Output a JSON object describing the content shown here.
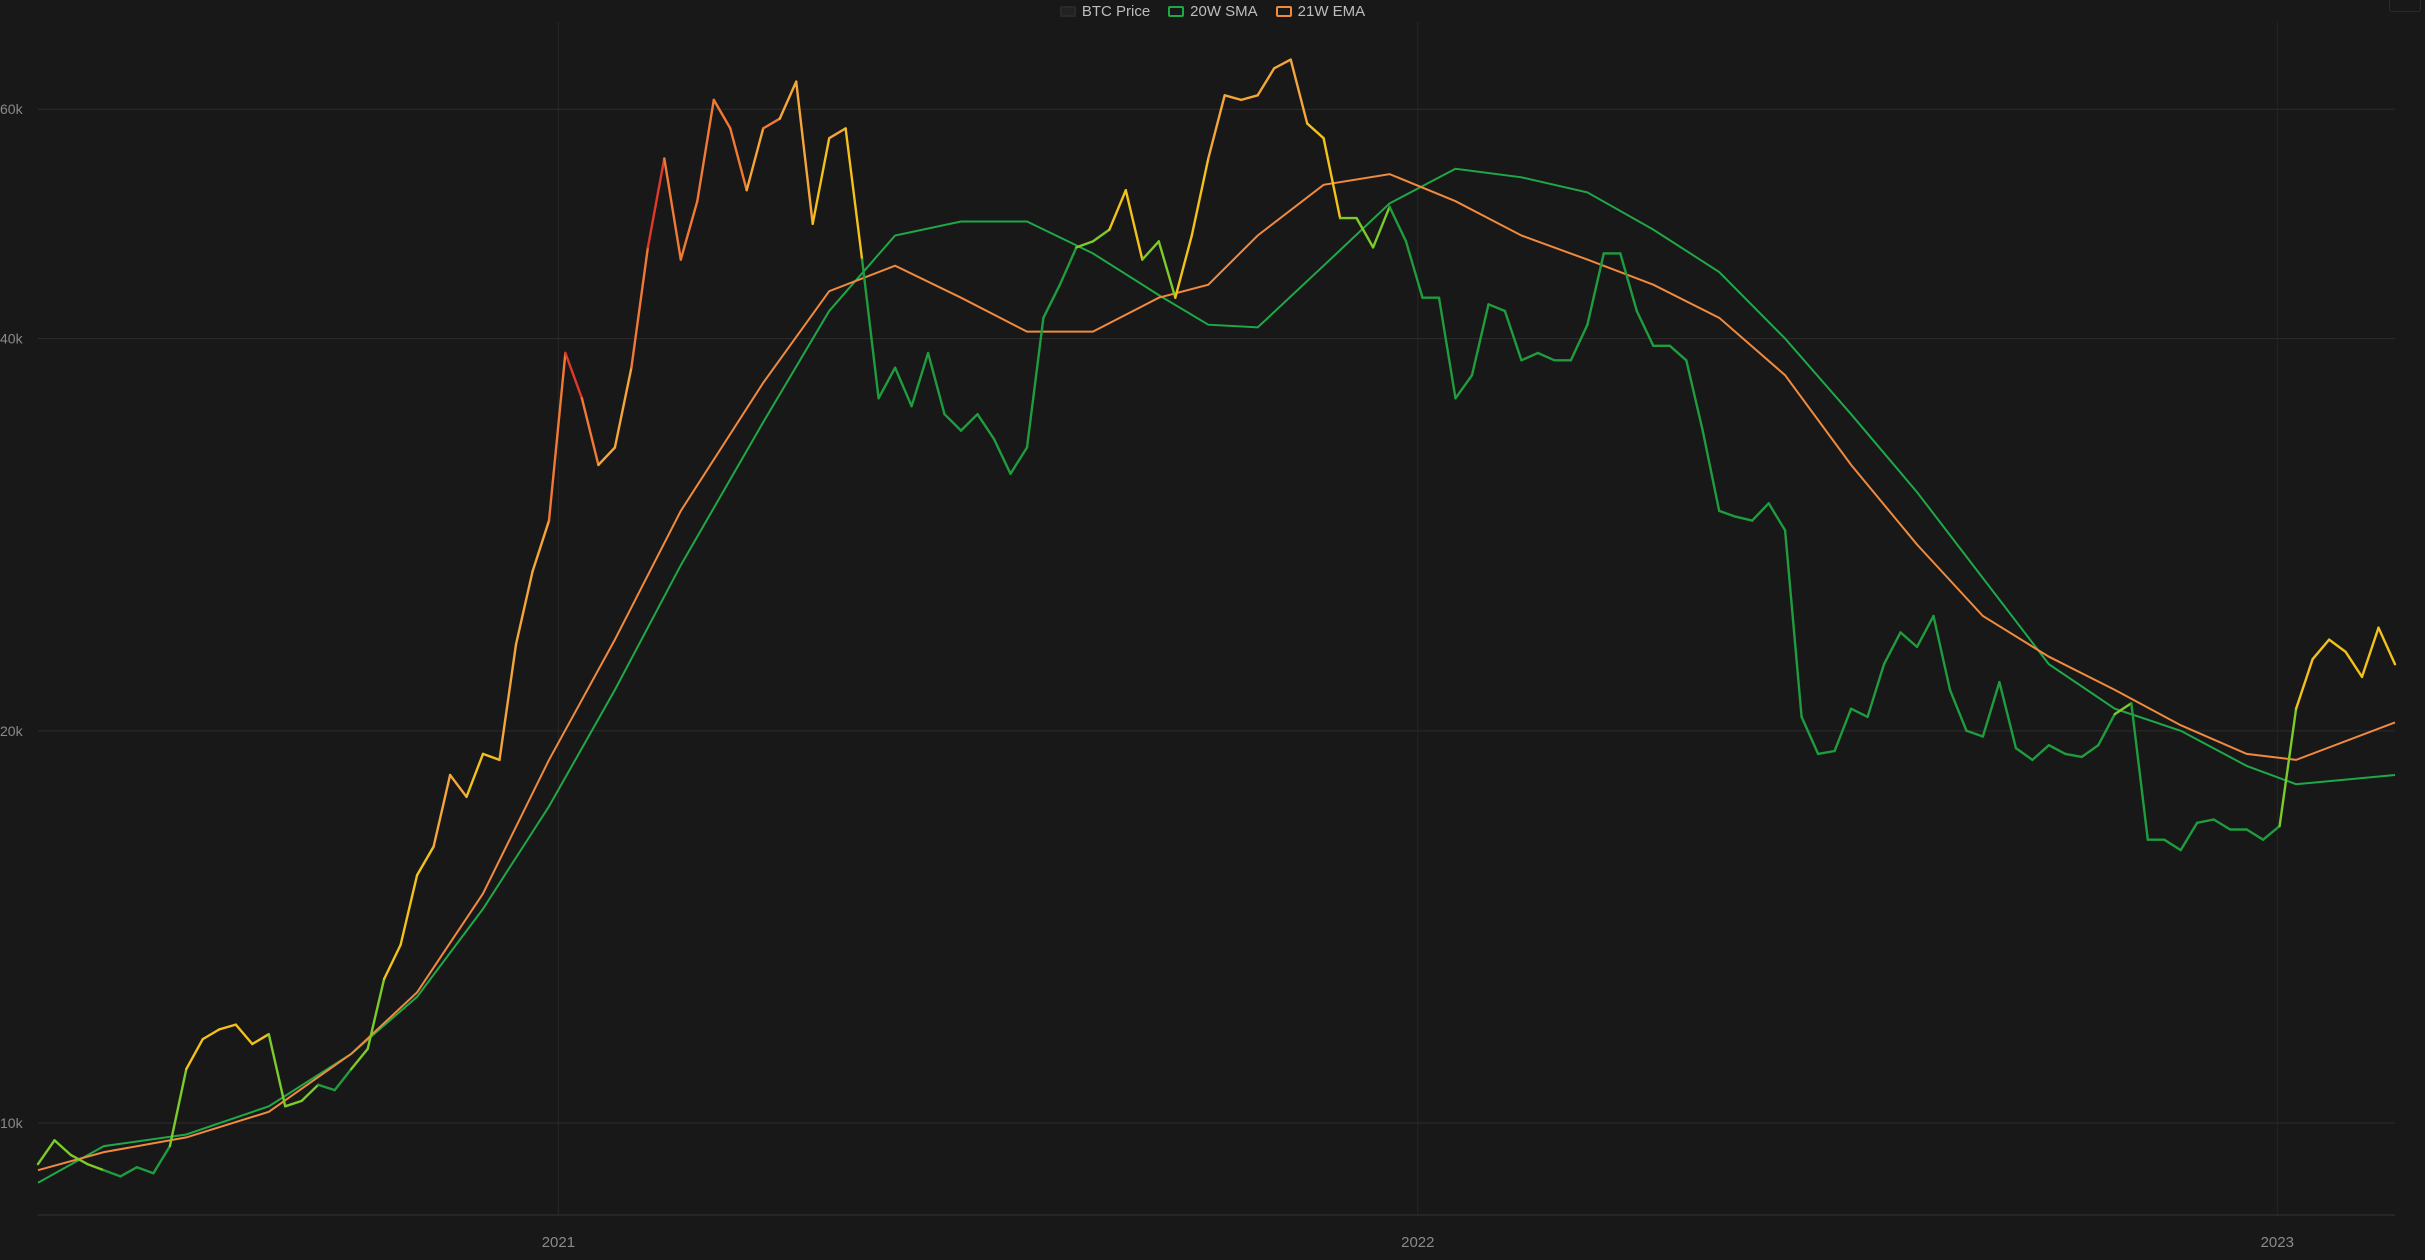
{
  "chart_data": {
    "type": "line",
    "title": "",
    "xlabel": "",
    "ylabel": "",
    "y_scale": "log",
    "ylim": [
      8500,
      70000
    ],
    "xlim": [
      "2020-05-25",
      "2023-02-20"
    ],
    "y_ticks": [
      {
        "value": 10000,
        "label": "10k"
      },
      {
        "value": 20000,
        "label": "20k"
      },
      {
        "value": 40000,
        "label": "40k"
      },
      {
        "value": 60000,
        "label": "60k"
      }
    ],
    "x_ticks": [
      {
        "date": "2021-01-01",
        "label": "2021"
      },
      {
        "date": "2022-01-01",
        "label": "2022"
      },
      {
        "date": "2023-01-01",
        "label": "2023"
      }
    ],
    "grid": true,
    "legend_position": "top-center",
    "series": [
      {
        "name": "BTC Price",
        "color": "#222222",
        "line_colors": "gradient by distance from 20W SMA: green (below) → yellow → orange → red (far above)",
        "points": [
          [
            "2020-05-25",
            9300
          ],
          [
            "2020-06-01",
            9700
          ],
          [
            "2020-06-08",
            9450
          ],
          [
            "2020-06-15",
            9300
          ],
          [
            "2020-06-22",
            9200
          ],
          [
            "2020-06-29",
            9100
          ],
          [
            "2020-07-06",
            9250
          ],
          [
            "2020-07-13",
            9150
          ],
          [
            "2020-07-20",
            9600
          ],
          [
            "2020-07-27",
            11000
          ],
          [
            "2020-08-03",
            11600
          ],
          [
            "2020-08-10",
            11800
          ],
          [
            "2020-08-17",
            11900
          ],
          [
            "2020-08-24",
            11500
          ],
          [
            "2020-08-31",
            11700
          ],
          [
            "2020-09-07",
            10300
          ],
          [
            "2020-09-14",
            10400
          ],
          [
            "2020-09-21",
            10700
          ],
          [
            "2020-09-28",
            10600
          ],
          [
            "2020-10-05",
            11000
          ],
          [
            "2020-10-12",
            11400
          ],
          [
            "2020-10-19",
            12900
          ],
          [
            "2020-10-26",
            13700
          ],
          [
            "2020-11-02",
            15500
          ],
          [
            "2020-11-09",
            16300
          ],
          [
            "2020-11-16",
            18500
          ],
          [
            "2020-11-23",
            17800
          ],
          [
            "2020-11-30",
            19200
          ],
          [
            "2020-12-07",
            19000
          ],
          [
            "2020-12-14",
            23300
          ],
          [
            "2020-12-21",
            26500
          ],
          [
            "2020-12-28",
            29000
          ],
          [
            "2021-01-04",
            39000
          ],
          [
            "2021-01-11",
            36000
          ],
          [
            "2021-01-18",
            32000
          ],
          [
            "2021-01-25",
            33000
          ],
          [
            "2021-02-01",
            38000
          ],
          [
            "2021-02-08",
            47000
          ],
          [
            "2021-02-15",
            55000
          ],
          [
            "2021-02-22",
            46000
          ],
          [
            "2021-03-01",
            51000
          ],
          [
            "2021-03-08",
            61000
          ],
          [
            "2021-03-15",
            58000
          ],
          [
            "2021-03-22",
            52000
          ],
          [
            "2021-03-29",
            58000
          ],
          [
            "2021-04-05",
            59000
          ],
          [
            "2021-04-12",
            63000
          ],
          [
            "2021-04-19",
            49000
          ],
          [
            "2021-04-26",
            57000
          ],
          [
            "2021-05-03",
            58000
          ],
          [
            "2021-05-10",
            46000
          ],
          [
            "2021-05-17",
            36000
          ],
          [
            "2021-05-24",
            38000
          ],
          [
            "2021-05-31",
            35500
          ],
          [
            "2021-06-07",
            39000
          ],
          [
            "2021-06-14",
            35000
          ],
          [
            "2021-06-21",
            34000
          ],
          [
            "2021-06-28",
            35000
          ],
          [
            "2021-07-05",
            33500
          ],
          [
            "2021-07-12",
            31500
          ],
          [
            "2021-07-19",
            33000
          ],
          [
            "2021-07-26",
            41500
          ],
          [
            "2021-08-02",
            44000
          ],
          [
            "2021-08-09",
            47000
          ],
          [
            "2021-08-16",
            47500
          ],
          [
            "2021-08-23",
            48500
          ],
          [
            "2021-08-30",
            52000
          ],
          [
            "2021-09-06",
            46000
          ],
          [
            "2021-09-13",
            47500
          ],
          [
            "2021-09-20",
            43000
          ],
          [
            "2021-09-27",
            48000
          ],
          [
            "2021-10-04",
            55000
          ],
          [
            "2021-10-11",
            61500
          ],
          [
            "2021-10-18",
            61000
          ],
          [
            "2021-10-25",
            61500
          ],
          [
            "2021-11-01",
            64500
          ],
          [
            "2021-11-08",
            65500
          ],
          [
            "2021-11-15",
            58500
          ],
          [
            "2021-11-22",
            57000
          ],
          [
            "2021-11-29",
            49500
          ],
          [
            "2021-12-06",
            49500
          ],
          [
            "2021-12-13",
            47000
          ],
          [
            "2021-12-20",
            50500
          ],
          [
            "2021-12-27",
            47500
          ],
          [
            "2022-01-03",
            43000
          ],
          [
            "2022-01-10",
            43000
          ],
          [
            "2022-01-17",
            36000
          ],
          [
            "2022-01-24",
            37500
          ],
          [
            "2022-01-31",
            42500
          ],
          [
            "2022-02-07",
            42000
          ],
          [
            "2022-02-14",
            38500
          ],
          [
            "2022-02-21",
            39000
          ],
          [
            "2022-02-28",
            38500
          ],
          [
            "2022-03-07",
            38500
          ],
          [
            "2022-03-14",
            41000
          ],
          [
            "2022-03-21",
            46500
          ],
          [
            "2022-03-28",
            46500
          ],
          [
            "2022-04-04",
            42000
          ],
          [
            "2022-04-11",
            39500
          ],
          [
            "2022-04-18",
            39500
          ],
          [
            "2022-04-25",
            38500
          ],
          [
            "2022-05-02",
            34000
          ],
          [
            "2022-05-09",
            29500
          ],
          [
            "2022-05-16",
            29200
          ],
          [
            "2022-05-23",
            29000
          ],
          [
            "2022-05-30",
            29900
          ],
          [
            "2022-06-06",
            28500
          ],
          [
            "2022-06-13",
            20500
          ],
          [
            "2022-06-20",
            19200
          ],
          [
            "2022-06-27",
            19300
          ],
          [
            "2022-07-04",
            20800
          ],
          [
            "2022-07-11",
            20500
          ],
          [
            "2022-07-18",
            22500
          ],
          [
            "2022-07-25",
            23800
          ],
          [
            "2022-08-01",
            23200
          ],
          [
            "2022-08-08",
            24500
          ],
          [
            "2022-08-15",
            21500
          ],
          [
            "2022-08-22",
            20000
          ],
          [
            "2022-08-29",
            19800
          ],
          [
            "2022-09-05",
            21800
          ],
          [
            "2022-09-12",
            19400
          ],
          [
            "2022-09-19",
            19000
          ],
          [
            "2022-09-26",
            19500
          ],
          [
            "2022-10-03",
            19200
          ],
          [
            "2022-10-10",
            19100
          ],
          [
            "2022-10-17",
            19500
          ],
          [
            "2022-10-24",
            20600
          ],
          [
            "2022-10-31",
            21000
          ],
          [
            "2022-11-07",
            16500
          ],
          [
            "2022-11-14",
            16500
          ],
          [
            "2022-11-21",
            16200
          ],
          [
            "2022-11-28",
            17000
          ],
          [
            "2022-12-05",
            17100
          ],
          [
            "2022-12-12",
            16800
          ],
          [
            "2022-12-19",
            16800
          ],
          [
            "2022-12-26",
            16500
          ],
          [
            "2023-01-02",
            16900
          ],
          [
            "2023-01-09",
            20800
          ],
          [
            "2023-01-16",
            22700
          ],
          [
            "2023-01-23",
            23500
          ],
          [
            "2023-01-30",
            23000
          ],
          [
            "2023-02-06",
            22000
          ],
          [
            "2023-02-13",
            24000
          ],
          [
            "2023-02-20",
            22500
          ]
        ]
      },
      {
        "name": "20W SMA",
        "color": "#1fa847",
        "points": [
          [
            "2020-05-25",
            9000
          ],
          [
            "2020-06-22",
            9600
          ],
          [
            "2020-07-27",
            9800
          ],
          [
            "2020-08-31",
            10300
          ],
          [
            "2020-10-05",
            11300
          ],
          [
            "2020-11-02",
            12500
          ],
          [
            "2020-11-30",
            14600
          ],
          [
            "2020-12-28",
            17500
          ],
          [
            "2021-01-25",
            21500
          ],
          [
            "2021-02-22",
            26800
          ],
          [
            "2021-03-29",
            34500
          ],
          [
            "2021-04-26",
            42000
          ],
          [
            "2021-05-24",
            48000
          ],
          [
            "2021-06-21",
            49200
          ],
          [
            "2021-07-19",
            49200
          ],
          [
            "2021-08-16",
            46500
          ],
          [
            "2021-09-13",
            43200
          ],
          [
            "2021-10-04",
            41000
          ],
          [
            "2021-10-25",
            40800
          ],
          [
            "2021-11-22",
            45500
          ],
          [
            "2021-12-20",
            50800
          ],
          [
            "2022-01-17",
            54000
          ],
          [
            "2022-02-14",
            53200
          ],
          [
            "2022-03-14",
            51800
          ],
          [
            "2022-04-11",
            48500
          ],
          [
            "2022-05-09",
            45000
          ],
          [
            "2022-06-06",
            40000
          ],
          [
            "2022-07-04",
            35000
          ],
          [
            "2022-08-01",
            30500
          ],
          [
            "2022-08-29",
            26200
          ],
          [
            "2022-09-26",
            22500
          ],
          [
            "2022-10-24",
            20800
          ],
          [
            "2022-11-21",
            20000
          ],
          [
            "2022-12-19",
            18800
          ],
          [
            "2023-01-09",
            18200
          ],
          [
            "2023-02-20",
            18500
          ]
        ]
      },
      {
        "name": "21W EMA",
        "color": "#f08a3e",
        "points": [
          [
            "2020-05-25",
            9200
          ],
          [
            "2020-06-22",
            9500
          ],
          [
            "2020-07-27",
            9750
          ],
          [
            "2020-08-31",
            10200
          ],
          [
            "2020-10-05",
            11300
          ],
          [
            "2020-11-02",
            12600
          ],
          [
            "2020-11-30",
            15000
          ],
          [
            "2020-12-28",
            19000
          ],
          [
            "2021-01-25",
            23500
          ],
          [
            "2021-02-22",
            29500
          ],
          [
            "2021-03-29",
            37000
          ],
          [
            "2021-04-26",
            43500
          ],
          [
            "2021-05-24",
            45500
          ],
          [
            "2021-06-21",
            43000
          ],
          [
            "2021-07-19",
            40500
          ],
          [
            "2021-08-16",
            40500
          ],
          [
            "2021-09-13",
            43000
          ],
          [
            "2021-10-04",
            44000
          ],
          [
            "2021-10-25",
            48000
          ],
          [
            "2021-11-22",
            52500
          ],
          [
            "2021-12-20",
            53500
          ],
          [
            "2022-01-17",
            51000
          ],
          [
            "2022-02-14",
            48000
          ],
          [
            "2022-03-14",
            46000
          ],
          [
            "2022-04-11",
            44000
          ],
          [
            "2022-05-09",
            41500
          ],
          [
            "2022-06-06",
            37500
          ],
          [
            "2022-07-04",
            32000
          ],
          [
            "2022-08-01",
            27800
          ],
          [
            "2022-08-29",
            24500
          ],
          [
            "2022-09-26",
            22800
          ],
          [
            "2022-10-24",
            21500
          ],
          [
            "2022-11-21",
            20200
          ],
          [
            "2022-12-19",
            19200
          ],
          [
            "2023-01-09",
            19000
          ],
          [
            "2023-02-20",
            20300
          ]
        ]
      }
    ]
  }
}
